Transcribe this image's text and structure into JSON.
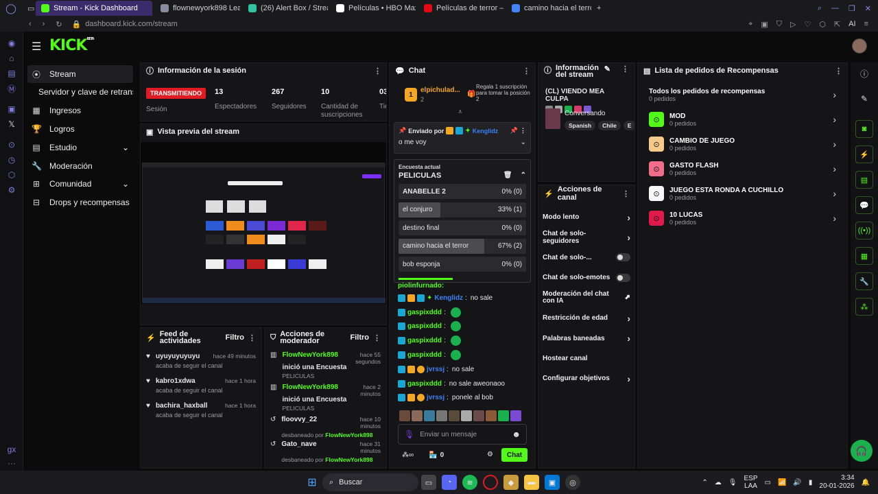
{
  "browser": {
    "tabs": [
      {
        "label": "Stream - Kick Dashboard",
        "color": "#53fc18",
        "active": true
      },
      {
        "label": "flownewyork898 LeaderB",
        "color": "#8a8aa0"
      },
      {
        "label": "(26) Alert Box / Streamlab",
        "color": "#31c3a2"
      },
      {
        "label": "Películas • HBO Max",
        "color": "#ffffff"
      },
      {
        "label": "Películas de terror — Netf",
        "color": "#e50914"
      },
      {
        "label": "camino hacia el terror - Bu",
        "color": "#4285f4"
      }
    ],
    "new_tab": "+",
    "url": "dashboard.kick.com/stream",
    "ai_label": "AI"
  },
  "header": {
    "logo": "KICK",
    "logo_sup": "BETA"
  },
  "sidebar": {
    "items": [
      {
        "label": "Stream",
        "icon": "broadcast-icon",
        "glyph": "⦿"
      },
      {
        "label": "Servidor y clave de retransmisión",
        "icon": "",
        "glyph": ""
      },
      {
        "label": "Ingresos",
        "icon": "chart-icon",
        "glyph": "▦"
      },
      {
        "label": "Logros",
        "icon": "trophy-icon",
        "glyph": "🏆"
      },
      {
        "label": "Estudio",
        "icon": "studio-icon",
        "glyph": "▤",
        "chevron": "⌄"
      },
      {
        "label": "Moderación",
        "icon": "wrench-icon",
        "glyph": "🔧"
      },
      {
        "label": "Comunidad",
        "icon": "community-icon",
        "glyph": "⊞",
        "chevron": "⌄"
      },
      {
        "label": "Drops y recompensas",
        "icon": "drops-icon",
        "glyph": "⊟"
      }
    ]
  },
  "session": {
    "title": "Información de la sesión",
    "status": "TRANSMITIENDO",
    "status_label": "Sesión",
    "stats": [
      {
        "value": "13",
        "label": "Espectadores"
      },
      {
        "value": "267",
        "label": "Seguidores"
      },
      {
        "value": "10",
        "label": "Cantidad de suscripciones"
      },
      {
        "value": "03",
        "label": "Tie en"
      }
    ]
  },
  "preview": {
    "title": "Vista previa del stream"
  },
  "feed": {
    "title": "Feed de actividades",
    "filter": "Filtro",
    "items": [
      {
        "user": "uyuyuyuyuyu",
        "time": "hace 49 minutos",
        "action": "acaba de seguir el canal"
      },
      {
        "user": "kabro1xdwa",
        "time": "hace 1 hora",
        "action": "acaba de seguir el canal"
      },
      {
        "user": "bachira_haxball",
        "time": "hace 1 hora",
        "action": "acaba de seguir el canal"
      }
    ]
  },
  "modactions": {
    "title": "Acciones de moderador",
    "filter": "Filtro",
    "items": [
      {
        "user": "FlowNewYork898",
        "action": "inició una Encuesta",
        "sub": "PELICULAS",
        "time": "hace 55 segundos"
      },
      {
        "user": "FlowNewYork898",
        "action": "inició una Encuesta",
        "sub": "PELICULAS",
        "time": "hace 2 minutos"
      },
      {
        "user": "floovvy_22",
        "action": "desbaneado por",
        "by": "FlowNewYork898",
        "time": "hace 10 minutos"
      },
      {
        "user": "Gato_nave",
        "action": "desbaneado por",
        "by": "FlowNewYork898",
        "time": "hace 31 minutos"
      }
    ]
  },
  "chat": {
    "title": "Chat",
    "top_gifter": {
      "rank": "1",
      "name": "elpichulad...",
      "count": "2"
    },
    "gift_promo": "Regala 1 suscripción para tomar la posición 2",
    "pinned": {
      "label": "Enviado por",
      "user": "Kenglidz",
      "message": "o me voy"
    },
    "poll": {
      "label": "Encuesta actual",
      "title": "PELICULAS",
      "options": [
        {
          "name": "ANABELLE 2",
          "pct": 0,
          "result": "0% (0)"
        },
        {
          "name": "el conjuro",
          "pct": 33,
          "result": "33% (1)"
        },
        {
          "name": "destino final",
          "pct": 0,
          "result": "0% (0)"
        },
        {
          "name": "camino hacia el terror",
          "pct": 67,
          "result": "67% (2)"
        },
        {
          "name": "bob esponja",
          "pct": 0,
          "result": "0% (0)"
        }
      ],
      "time_left": 0.42
    },
    "messages": [
      {
        "user": "Kenglidz",
        "color": "#3b82f6",
        "text": "no sale"
      },
      {
        "user": "gaspixddd",
        "color": "#3b82f6",
        "text": ""
      },
      {
        "user": "gaspixddd",
        "color": "#3b82f6",
        "text": ""
      },
      {
        "user": "gaspixddd",
        "color": "#3b82f6",
        "text": ""
      },
      {
        "user": "gaspixddd",
        "color": "#3b82f6",
        "text": ""
      },
      {
        "user": "jvrssj",
        "color": "#3b82f6",
        "text": "no sale"
      },
      {
        "user": "gaspixddd",
        "color": "#3b82f6",
        "text": "no sale aweonaoo"
      },
      {
        "user": "jvrssj",
        "color": "#3b82f6",
        "text": "ponele al bob"
      }
    ],
    "input_placeholder": "Enviar un mensaje",
    "points": "0",
    "send": "Chat"
  },
  "streaminfo": {
    "title": "Información del stream",
    "stream_title": "(CL) VIENDO MEA CULPA",
    "category": "Conversando",
    "tags": [
      "Spanish",
      "Chile",
      "E"
    ]
  },
  "actions": {
    "title": "Acciones de canal",
    "items": [
      {
        "label": "Modo lento",
        "type": "chevron"
      },
      {
        "label": "Chat de solo-seguidores",
        "type": "chevron"
      },
      {
        "label": "Chat de solo-...",
        "type": "toggle"
      },
      {
        "label": "Chat de solo-emotes",
        "type": "toggle"
      },
      {
        "label": "Moderación del chat con IA",
        "type": "external"
      },
      {
        "label": "Restricción de edad",
        "type": "chevron"
      },
      {
        "label": "Palabras baneadas",
        "type": "chevron"
      },
      {
        "label": "Hostear canal",
        "type": "none"
      },
      {
        "label": "Configurar objetivos",
        "type": "chevron"
      }
    ]
  },
  "rewards": {
    "title": "Lista de pedidos de Recompensas",
    "all": {
      "label": "Todos los pedidos de recompensas",
      "count": "0 pedidos"
    },
    "items": [
      {
        "label": "MOD",
        "count": "0 pedidos",
        "color": "#53fc18"
      },
      {
        "label": "CAMBIO DE JUEGO",
        "count": "0 pedidos",
        "color": "#f7c98b"
      },
      {
        "label": "GASTO FLASH",
        "count": "0 pedidos",
        "color": "#f26d8a"
      },
      {
        "label": "JUEGO ESTA RONDA A CUCHILLO",
        "count": "0 pedidos",
        "color": "#f7f7f7"
      },
      {
        "label": "10 LUCAS",
        "count": "0 pedidos",
        "color": "#e01b4c"
      }
    ]
  },
  "taskbar": {
    "search": "Buscar",
    "lang": "ESP",
    "region": "LAA",
    "time": "3:34",
    "date": "20-01-2026"
  }
}
